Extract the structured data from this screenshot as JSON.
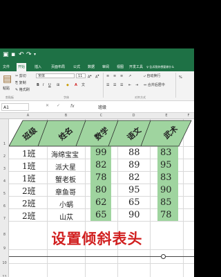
{
  "titlebar": {
    "save_icon": "save-icon",
    "undo_icon": "undo-icon",
    "redo_icon": "redo-icon",
    "title": ""
  },
  "tabs": [
    "文件",
    "开始",
    "插入",
    "页面布局",
    "公式",
    "数据",
    "审阅",
    "视图",
    "开发工具"
  ],
  "active_tab": "开始",
  "tell_me": "告诉我你想要做什么",
  "ribbon": {
    "paste": "粘贴",
    "cut": "剪切",
    "copy": "复制",
    "format_painter": "格式刷",
    "clipboard": "剪贴板",
    "font_name": "宋体",
    "font_size": "11",
    "font_group": "字体",
    "align_group": "对齐方式",
    "wrap_text": "自动换行",
    "merge_center": "合并后居中"
  },
  "formula_bar": {
    "name_box": "A1",
    "fx": "fx",
    "value": "班级"
  },
  "columns": [
    "A",
    "B",
    "C",
    "D",
    "E",
    "F"
  ],
  "rows": [
    "1",
    "2",
    "3",
    "4",
    "5",
    "6",
    "7",
    "8",
    "9",
    "10",
    "11"
  ],
  "header_cells": [
    "班级",
    "姓名",
    "数学",
    "语文",
    "武术"
  ],
  "table": [
    {
      "cls": "1班",
      "name": "海绵宝宝",
      "math": "99",
      "chinese": "88",
      "wushu": "83"
    },
    {
      "cls": "1班",
      "name": "派大星",
      "math": "82",
      "chinese": "89",
      "wushu": "95"
    },
    {
      "cls": "1班",
      "name": "蟹老板",
      "math": "78",
      "chinese": "82",
      "wushu": "83"
    },
    {
      "cls": "2班",
      "name": "章鱼哥",
      "math": "80",
      "chinese": "95",
      "wushu": "90"
    },
    {
      "cls": "2班",
      "name": "小蜗",
      "math": "62",
      "chinese": "65",
      "wushu": "85"
    },
    {
      "cls": "2班",
      "name": "山苁",
      "math": "65",
      "chinese": "90",
      "wushu": "78"
    }
  ],
  "caption": "设置倾斜表头",
  "colors": {
    "accent": "#1e7145",
    "header_fill": "#9fd49f",
    "caption": "#d11f1f"
  }
}
